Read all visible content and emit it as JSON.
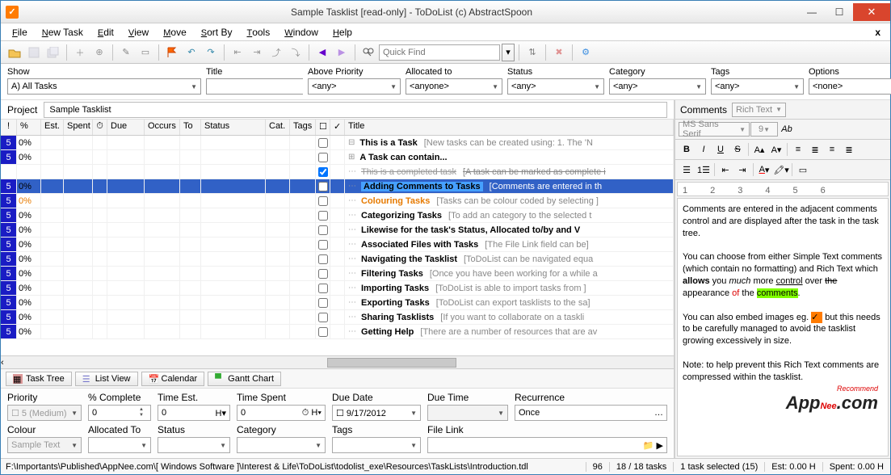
{
  "window": {
    "title": "Sample Tasklist [read-only] - ToDoList (c) AbstractSpoon"
  },
  "menu": [
    "File",
    "New Task",
    "Edit",
    "View",
    "Move",
    "Sort By",
    "Tools",
    "Window",
    "Help"
  ],
  "quickfind_placeholder": "Quick Find",
  "filters": {
    "show": {
      "label": "Show",
      "value": "A)  All Tasks"
    },
    "title": {
      "label": "Title",
      "value": ""
    },
    "above_priority": {
      "label": "Above Priority",
      "value": "<any>"
    },
    "allocated_to": {
      "label": "Allocated to",
      "value": "<anyone>"
    },
    "status": {
      "label": "Status",
      "value": "<any>"
    },
    "category": {
      "label": "Category",
      "value": "<any>"
    },
    "tags": {
      "label": "Tags",
      "value": "<any>"
    },
    "options": {
      "label": "Options",
      "value": "<none>"
    }
  },
  "project": {
    "label": "Project",
    "value": "Sample Tasklist"
  },
  "grid": {
    "columns": [
      "!",
      "%",
      "Est.",
      "Spent",
      "⏱",
      "Due",
      "Occurs",
      "To",
      "Status",
      "Cat.",
      "Tags",
      "☐",
      "✓",
      "Title"
    ],
    "rows": [
      {
        "pri": "5",
        "pct": "0%",
        "exp": "⊟",
        "title": "This is a Task",
        "note": "[New tasks can be created using:  1. The 'N"
      },
      {
        "pri": "5",
        "pct": "0%",
        "exp": "⊞",
        "title": "A Task can contain...",
        "note": ""
      },
      {
        "pri": "",
        "pct": "",
        "exp": "",
        "checked": true,
        "strike": true,
        "title": "This is a completed task",
        "note": "[A task can be marked as complete i"
      },
      {
        "pri": "5",
        "pct": "0%",
        "exp": "",
        "sel": true,
        "badge": "Adding Comments to Tasks",
        "note": "[Comments are entered in th"
      },
      {
        "pri": "5",
        "pct": "0%",
        "exp": "",
        "color": "orange",
        "title": "Colouring Tasks",
        "note": "[Tasks can be colour coded by selecting ]"
      },
      {
        "pri": "5",
        "pct": "0%",
        "exp": "",
        "title": "Categorizing Tasks",
        "note": "[To add an category to the selected t"
      },
      {
        "pri": "5",
        "pct": "0%",
        "exp": "",
        "title": "Likewise for the task's Status, Allocated to/by and V",
        "note": ""
      },
      {
        "pri": "5",
        "pct": "0%",
        "exp": "",
        "title": "Associated Files with Tasks",
        "note": "[The File Link field can be]"
      },
      {
        "pri": "5",
        "pct": "0%",
        "exp": "",
        "title": "Navigating the Tasklist",
        "note": "[ToDoList can be navigated equa"
      },
      {
        "pri": "5",
        "pct": "0%",
        "exp": "",
        "title": "Filtering Tasks",
        "note": "[Once you have been working for a while a"
      },
      {
        "pri": "5",
        "pct": "0%",
        "exp": "",
        "title": "Importing Tasks",
        "note": "[ToDoList is able to import tasks from ]"
      },
      {
        "pri": "5",
        "pct": "0%",
        "exp": "",
        "title": "Exporting Tasks",
        "note": "[ToDoList can export tasklists to the sa]"
      },
      {
        "pri": "5",
        "pct": "0%",
        "exp": "",
        "title": "Sharing Tasklists",
        "note": "[If you want to collaborate on a taskli"
      },
      {
        "pri": "5",
        "pct": "0%",
        "exp": "",
        "title": "Getting Help",
        "note": "[There are a number of resources that are av"
      }
    ]
  },
  "viewtabs": [
    "Task Tree",
    "List View",
    "Calendar",
    "Gantt Chart"
  ],
  "edit": {
    "r1": {
      "priority": {
        "label": "Priority",
        "value": "5 (Medium)"
      },
      "complete": {
        "label": "% Complete",
        "value": "0"
      },
      "timeest": {
        "label": "Time Est.",
        "value": "0",
        "unit": "H"
      },
      "timespent": {
        "label": "Time Spent",
        "value": "0",
        "unit": "H"
      },
      "duedate": {
        "label": "Due Date",
        "value": "9/17/2012"
      },
      "duetime": {
        "label": "Due Time",
        "value": ""
      },
      "recurrence": {
        "label": "Recurrence",
        "value": "Once"
      }
    },
    "r2": {
      "colour": {
        "label": "Colour",
        "value": "Sample Text"
      },
      "allocatedto": {
        "label": "Allocated To",
        "value": ""
      },
      "status": {
        "label": "Status",
        "value": ""
      },
      "category": {
        "label": "Category",
        "value": ""
      },
      "tags": {
        "label": "Tags",
        "value": ""
      },
      "filelink": {
        "label": "File Link",
        "value": ""
      }
    }
  },
  "comments": {
    "label": "Comments",
    "format": "Rich Text",
    "font": "MS Sans Serif",
    "size": "9",
    "ruler": [
      "1",
      "2",
      "3",
      "4",
      "5",
      "6"
    ]
  },
  "statusbar": {
    "path": "F:\\Importants\\Published\\AppNee.com\\[ Windows Software ]\\Interest & Life\\ToDoList\\todolist_exe\\Resources\\TaskLists\\Introduction.tdl",
    "cells": [
      "96",
      "18 / 18 tasks",
      "1 task selected (15)",
      "Est: 0.00 H",
      "Spent: 0.00 H"
    ]
  }
}
